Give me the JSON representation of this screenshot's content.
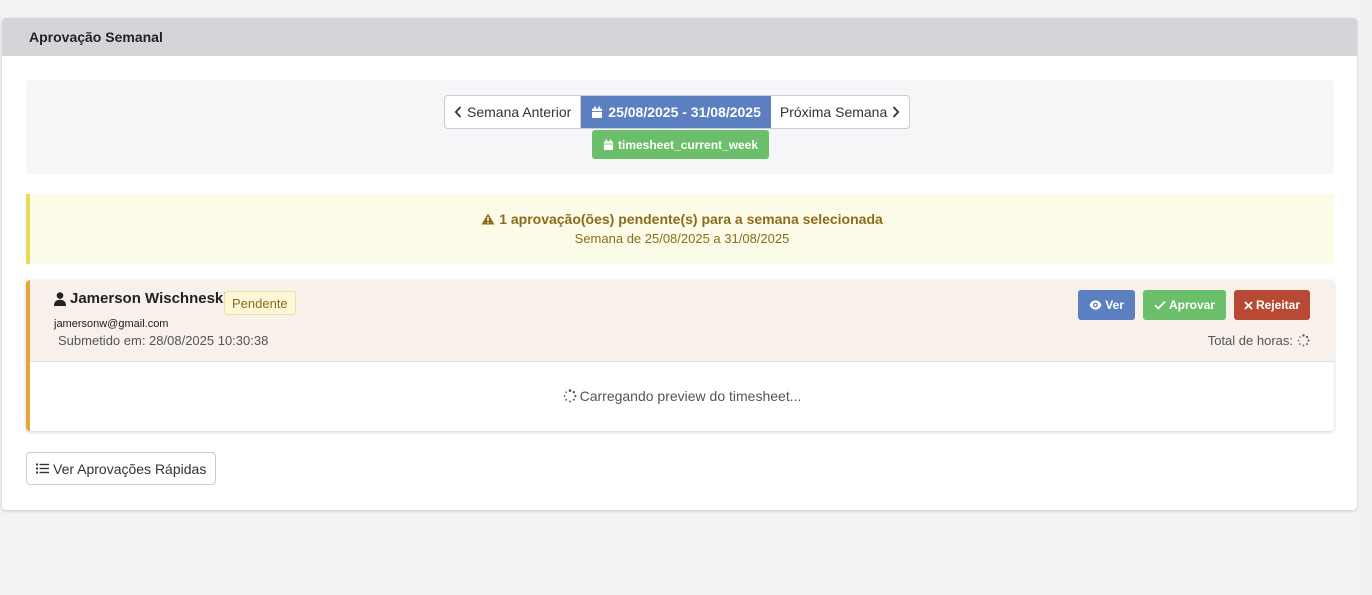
{
  "panel": {
    "title": "Aprovação Semanal"
  },
  "week_nav": {
    "prev_label": "Semana Anterior",
    "current_range": "25/08/2025 - 31/08/2025",
    "next_label": "Próxima Semana",
    "week_key": "timesheet_current_week"
  },
  "alert": {
    "message": "1 aprovação(ões) pendente(s) para a semana selecionada",
    "week_text": "Semana de 25/08/2025 a 31/08/2025"
  },
  "approval": {
    "user_name": "Jamerson Wischneski",
    "status": "Pendente",
    "email": "jamersonw@gmail.com",
    "submitted": "Submetido em: 28/08/2025 10:30:38",
    "total_label": "Total de horas:",
    "view_label": "Ver",
    "approve_label": "Aprovar",
    "reject_label": "Rejeitar",
    "loading_text": "Carregando preview do timesheet..."
  },
  "quick_approvals": {
    "label": "Ver Aprovações Rápidas"
  },
  "colors": {
    "primary": "#5b7fc0",
    "success": "#6bbf6b",
    "danger": "#b84a34",
    "warning_border": "#e7a43a",
    "alert_bg": "#fcfbe8"
  }
}
